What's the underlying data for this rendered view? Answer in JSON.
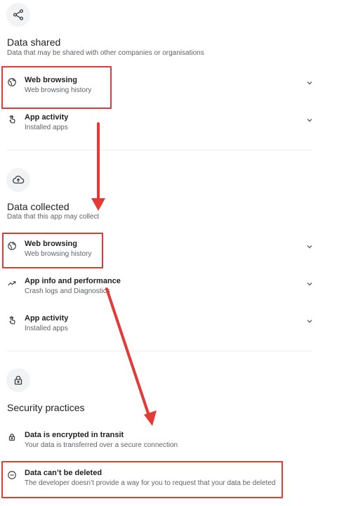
{
  "sections": {
    "shared": {
      "icon": "share-icon",
      "title": "Data shared",
      "subtitle": "Data that may be shared with other companies or organisations",
      "items": [
        {
          "icon": "globe-icon",
          "title": "Web browsing",
          "subtitle": "Web browsing history"
        },
        {
          "icon": "touch-icon",
          "title": "App activity",
          "subtitle": "Installed apps"
        }
      ]
    },
    "collected": {
      "icon": "cloud-upload-icon",
      "title": "Data collected",
      "subtitle": "Data that this app may collect",
      "items": [
        {
          "icon": "globe-icon",
          "title": "Web browsing",
          "subtitle": "Web browsing history"
        },
        {
          "icon": "trend-icon",
          "title": "App info and performance",
          "subtitle": "Crash logs and Diagnostics"
        },
        {
          "icon": "touch-icon",
          "title": "App activity",
          "subtitle": "Installed apps"
        }
      ]
    },
    "security": {
      "icon": "lock-icon",
      "title": "Security practices",
      "items": [
        {
          "icon": "lock-icon",
          "title": "Data is encrypted in transit",
          "subtitle": "Your data is transferred over a secure connection"
        },
        {
          "icon": "minus-circle-icon",
          "title": "Data can’t be deleted",
          "subtitle": "The developer doesn’t provide a way for you to request that your data be deleted"
        }
      ]
    }
  },
  "colors": {
    "annotation_red": "#e53935",
    "text_primary": "#202124",
    "text_secondary": "#5f6368",
    "icon_bg": "#f1f3f4"
  }
}
